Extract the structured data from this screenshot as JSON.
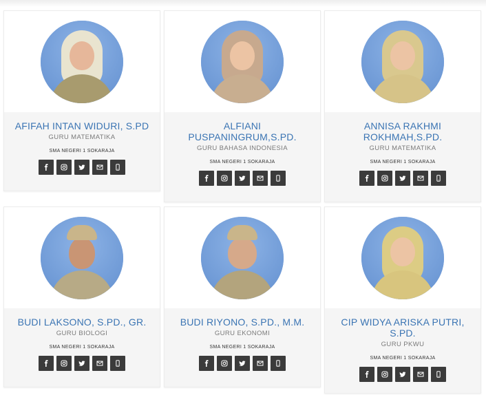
{
  "teachers": [
    {
      "name": "AFIFAH INTAN WIDURI, S.PD",
      "subject": "GURU MATEMATIKA",
      "school": "SMA NEGERI 1 SOKARAJA"
    },
    {
      "name": "ALFIANI PUSPANINGRUM,S.PD.",
      "subject": "GURU BAHASA INDONESIA",
      "school": "SMA NEGERI 1 SOKARAJA"
    },
    {
      "name": "ANNISA RAKHMI ROKHMAH,S.PD.",
      "subject": "GURU MATEMATIKA",
      "school": "SMA NEGERI 1 SOKARAJA"
    },
    {
      "name": "BUDI LAKSONO, S.PD., GR.",
      "subject": "GURU BIOLOGI",
      "school": "SMA NEGERI 1 SOKARAJA"
    },
    {
      "name": "BUDI RIYONO, S.PD., M.M.",
      "subject": "GURU EKONOMI",
      "school": "SMA NEGERI 1 SOKARAJA"
    },
    {
      "name": "CIP WIDYA ARISKA PUTRI, S.PD.",
      "subject": "GURU PKWU",
      "school": "SMA NEGERI 1 SOKARAJA"
    }
  ],
  "social_icons": [
    "facebook-icon",
    "instagram-icon",
    "twitter-icon",
    "email-icon",
    "phone-icon"
  ],
  "colors": {
    "name": "#3a74b3",
    "button": "#3b3b3b",
    "photo_bg": "#78a3dd",
    "card_bg": "#f5f5f5"
  }
}
